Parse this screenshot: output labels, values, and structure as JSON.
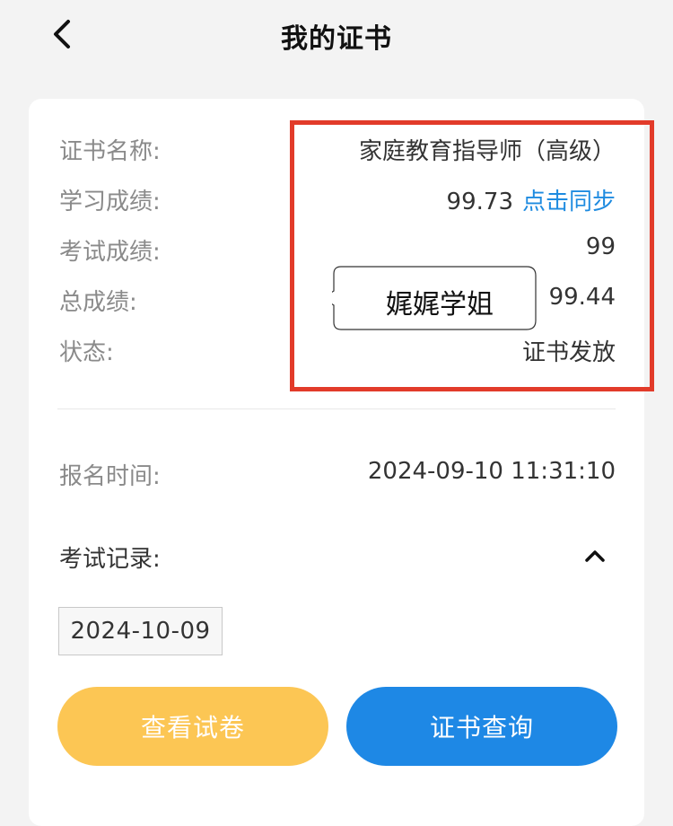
{
  "header": {
    "title": "我的证书"
  },
  "details": {
    "name_label": "证书名称:",
    "name_value": "家庭教育指导师（高级）",
    "study_label": "学习成绩:",
    "study_value": "99.73",
    "sync_link": "点击同步",
    "exam_label": "考试成绩:",
    "exam_value": "99",
    "total_label": "总成绩:",
    "total_value": "99.44",
    "status_label": "状态:",
    "status_value": "证书发放"
  },
  "registration": {
    "label": "报名时间:",
    "value": "2024-09-10 11:31:10"
  },
  "records": {
    "label": "考试记录:",
    "dates": [
      "2024-10-09"
    ]
  },
  "actions": {
    "view_paper": "查看试卷",
    "query_certificate": "证书查询"
  },
  "watermark": {
    "text": "娓娓学姐"
  },
  "icons": {
    "back": "chevron-left-icon",
    "collapse": "chevron-up-icon"
  },
  "colors": {
    "accent_blue": "#1e88e5",
    "link_blue": "#1e8be0",
    "accent_yellow": "#fcc654",
    "highlight_red": "#e23b2a"
  }
}
